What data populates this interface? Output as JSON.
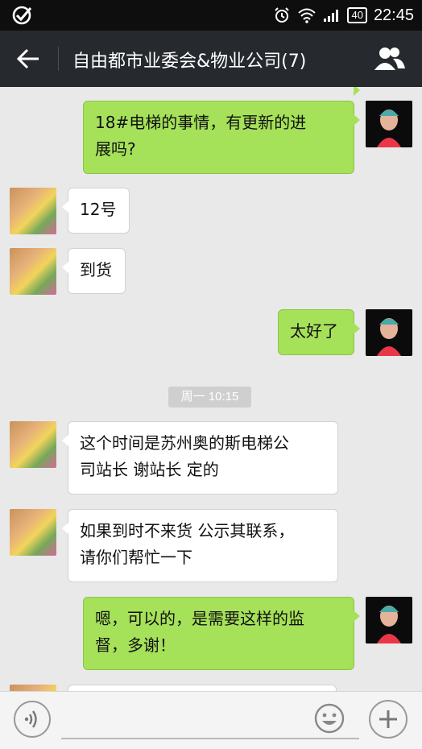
{
  "status_bar": {
    "time": "22:45",
    "battery": "40",
    "icons": [
      "check-circle-icon",
      "alarm-icon",
      "wifi-icon",
      "signal-icon",
      "battery-icon"
    ]
  },
  "header": {
    "title": "自由都市业委会&物业公司(7)",
    "back_icon": "back-arrow-icon",
    "members_icon": "group-members-icon"
  },
  "messages": [
    {
      "direction": "outgoing",
      "lines": [
        "18#电梯的事情，有更新的进",
        "展吗?"
      ]
    },
    {
      "direction": "incoming",
      "lines": [
        "12号"
      ]
    },
    {
      "direction": "incoming",
      "lines": [
        "到货"
      ]
    },
    {
      "direction": "outgoing",
      "lines": [
        "太好了"
      ]
    },
    {
      "direction": "incoming",
      "lines": [
        "这个时间是苏州奥的斯电梯公",
        "司站长  谢站长 定的"
      ]
    },
    {
      "direction": "incoming",
      "lines": [
        "如果到时不来货 公示其联系，",
        "请你们帮忙一下"
      ]
    },
    {
      "direction": "outgoing",
      "lines": [
        "嗯，可以的，是需要这样的监",
        "督，多谢！"
      ]
    }
  ],
  "timestamp": "周一 10:15",
  "bottom_bar": {
    "voice_icon": "voice-icon",
    "input_value": "",
    "emoji_icon": "emoji-icon",
    "plus_icon": "plus-icon"
  },
  "colors": {
    "topbar": "#262a2f",
    "outgoing_bubble": "#a6e15a",
    "incoming_bubble": "#ffffff",
    "chat_background": "#e9e9e9"
  }
}
